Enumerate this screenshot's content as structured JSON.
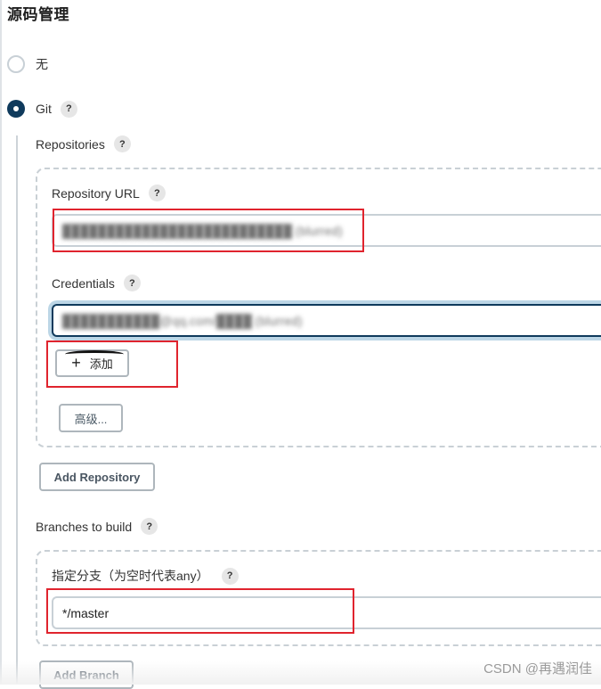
{
  "section": {
    "title": "源码管理"
  },
  "scm_options": [
    {
      "label": "无",
      "selected": false
    },
    {
      "label": "Git",
      "selected": true,
      "help": "?"
    }
  ],
  "repositories": {
    "label": "Repositories",
    "help": "?",
    "repository_url": {
      "label": "Repository URL",
      "help": "?",
      "value": "██████████████████████████ (blurred)"
    },
    "credentials": {
      "label": "Credentials",
      "help": "?",
      "value": "███████████@qq.com/████ (blurred)"
    },
    "add_button": {
      "icon": "plus-icon",
      "icon_glyph": "+",
      "label": "添加"
    },
    "advanced_button": {
      "label": "高级..."
    },
    "add_repository_button": {
      "label": "Add Repository"
    }
  },
  "branches": {
    "label": "Branches to build",
    "help": "?",
    "branch_specifier": {
      "label": "指定分支（为空时代表any）",
      "help": "?",
      "value": "*/master"
    },
    "add_branch_button": {
      "label": "Add Branch"
    }
  },
  "annotations": {
    "highlight_color": "#e0242e"
  },
  "watermark": "CSDN @再遇润佳"
}
